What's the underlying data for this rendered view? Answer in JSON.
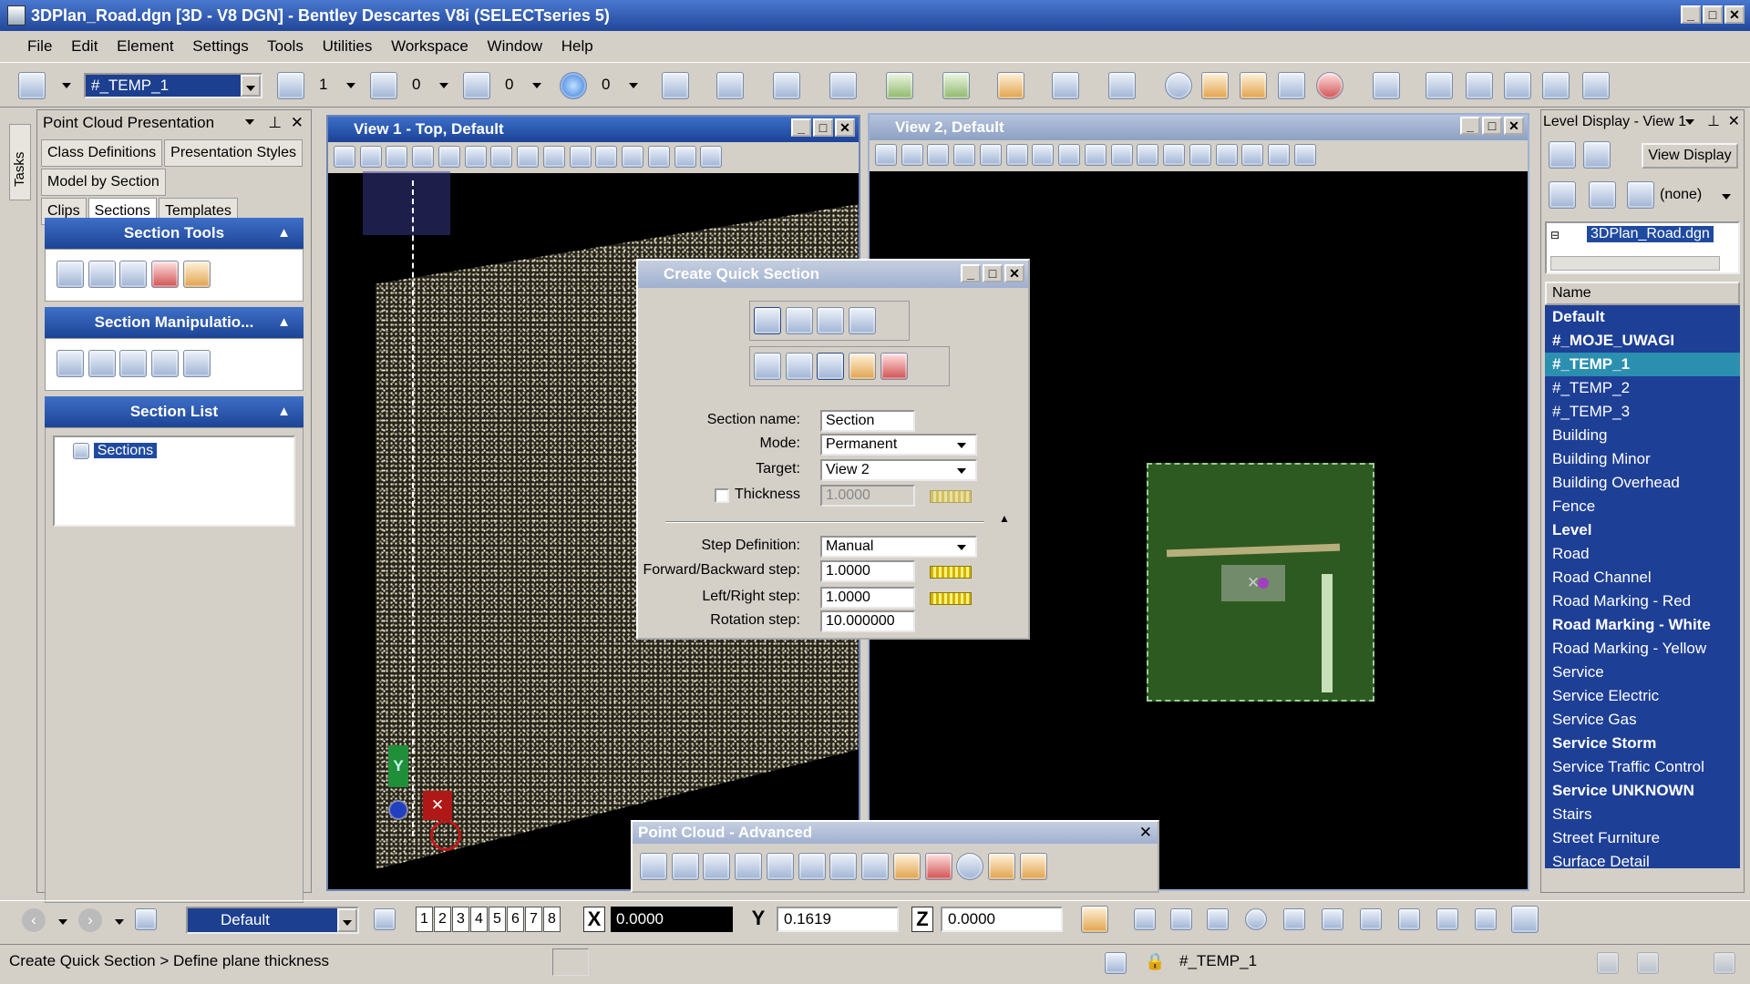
{
  "app": {
    "title": "3DPlan_Road.dgn [3D - V8 DGN] - Bentley Descartes V8i (SELECTseries 5)"
  },
  "menu": [
    "File",
    "Edit",
    "Element",
    "Settings",
    "Tools",
    "Utilities",
    "Workspace",
    "Window",
    "Help"
  ],
  "toolbar": {
    "active_level": "#_TEMP_1",
    "color": "1",
    "line_style": "0",
    "line_weight": "0",
    "transparency": "0"
  },
  "tasks_tab": "Tasks",
  "left_panel": {
    "title": "Point Cloud Presentation",
    "tabs": [
      "Class Definitions",
      "Presentation Styles",
      "Model by Section",
      "Clips",
      "Sections",
      "Templates"
    ],
    "section_tools": "Section Tools",
    "section_manip": "Section Manipulatio...",
    "section_list": "Section List",
    "tree_item": "Sections"
  },
  "view1": {
    "title": "View 1 - Top, Default",
    "axis_y": "Y"
  },
  "view2": {
    "title": "View 2, Default"
  },
  "dialog": {
    "title": "Create Quick Section",
    "section_name_label": "Section name:",
    "section_name": "Section",
    "mode_label": "Mode:",
    "mode": "Permanent",
    "target_label": "Target:",
    "target": "View 2",
    "thickness_label": "Thickness",
    "thickness": "1.0000",
    "step_def_label": "Step Definition:",
    "step_def": "Manual",
    "fb_label": "Forward/Backward step:",
    "fb": "1.0000",
    "lr_label": "Left/Right step:",
    "lr": "1.0000",
    "rot_label": "Rotation step:",
    "rot": "10.000000"
  },
  "pc_adv": {
    "title": "Point Cloud - Advanced"
  },
  "level_display": {
    "title": "Level Display - View 1",
    "view_display": "View Display",
    "filter": "(none)",
    "file": "3DPlan_Road.dgn",
    "col_name": "Name",
    "levels": [
      {
        "name": "Default",
        "bold": true
      },
      {
        "name": "#_MOJE_UWAGI",
        "bold": true
      },
      {
        "name": "#_TEMP_1",
        "bold": true,
        "selected": true
      },
      {
        "name": "#_TEMP_2",
        "bold": false
      },
      {
        "name": "#_TEMP_3",
        "bold": false
      },
      {
        "name": "Building",
        "bold": false
      },
      {
        "name": "Building Minor",
        "bold": false
      },
      {
        "name": "Building Overhead",
        "bold": false
      },
      {
        "name": "Fence",
        "bold": false
      },
      {
        "name": "Level",
        "bold": true
      },
      {
        "name": "Road",
        "bold": false
      },
      {
        "name": "Road Channel",
        "bold": false
      },
      {
        "name": "Road Marking - Red",
        "bold": false
      },
      {
        "name": "Road Marking - White",
        "bold": true
      },
      {
        "name": "Road Marking - Yellow",
        "bold": false
      },
      {
        "name": "Service",
        "bold": false
      },
      {
        "name": "Service Electric",
        "bold": false
      },
      {
        "name": "Service Gas",
        "bold": false
      },
      {
        "name": "Service Storm",
        "bold": true
      },
      {
        "name": "Service Traffic Control",
        "bold": false
      },
      {
        "name": "Service UNKNOWN",
        "bold": true
      },
      {
        "name": "Stairs",
        "bold": false
      },
      {
        "name": "Street Furniture",
        "bold": false
      },
      {
        "name": "Surface Detail",
        "bold": false
      }
    ]
  },
  "bottom": {
    "model": "Default",
    "view_numbers": [
      "1",
      "2",
      "3",
      "4",
      "5",
      "6",
      "7",
      "8"
    ],
    "x_label": "X",
    "x": "0.0000",
    "y_label": "Y",
    "y": "0.1619",
    "z_label": "Z",
    "z": "0.0000"
  },
  "status": {
    "prompt": "Create Quick Section > Define plane thickness",
    "level": "#_TEMP_1"
  }
}
